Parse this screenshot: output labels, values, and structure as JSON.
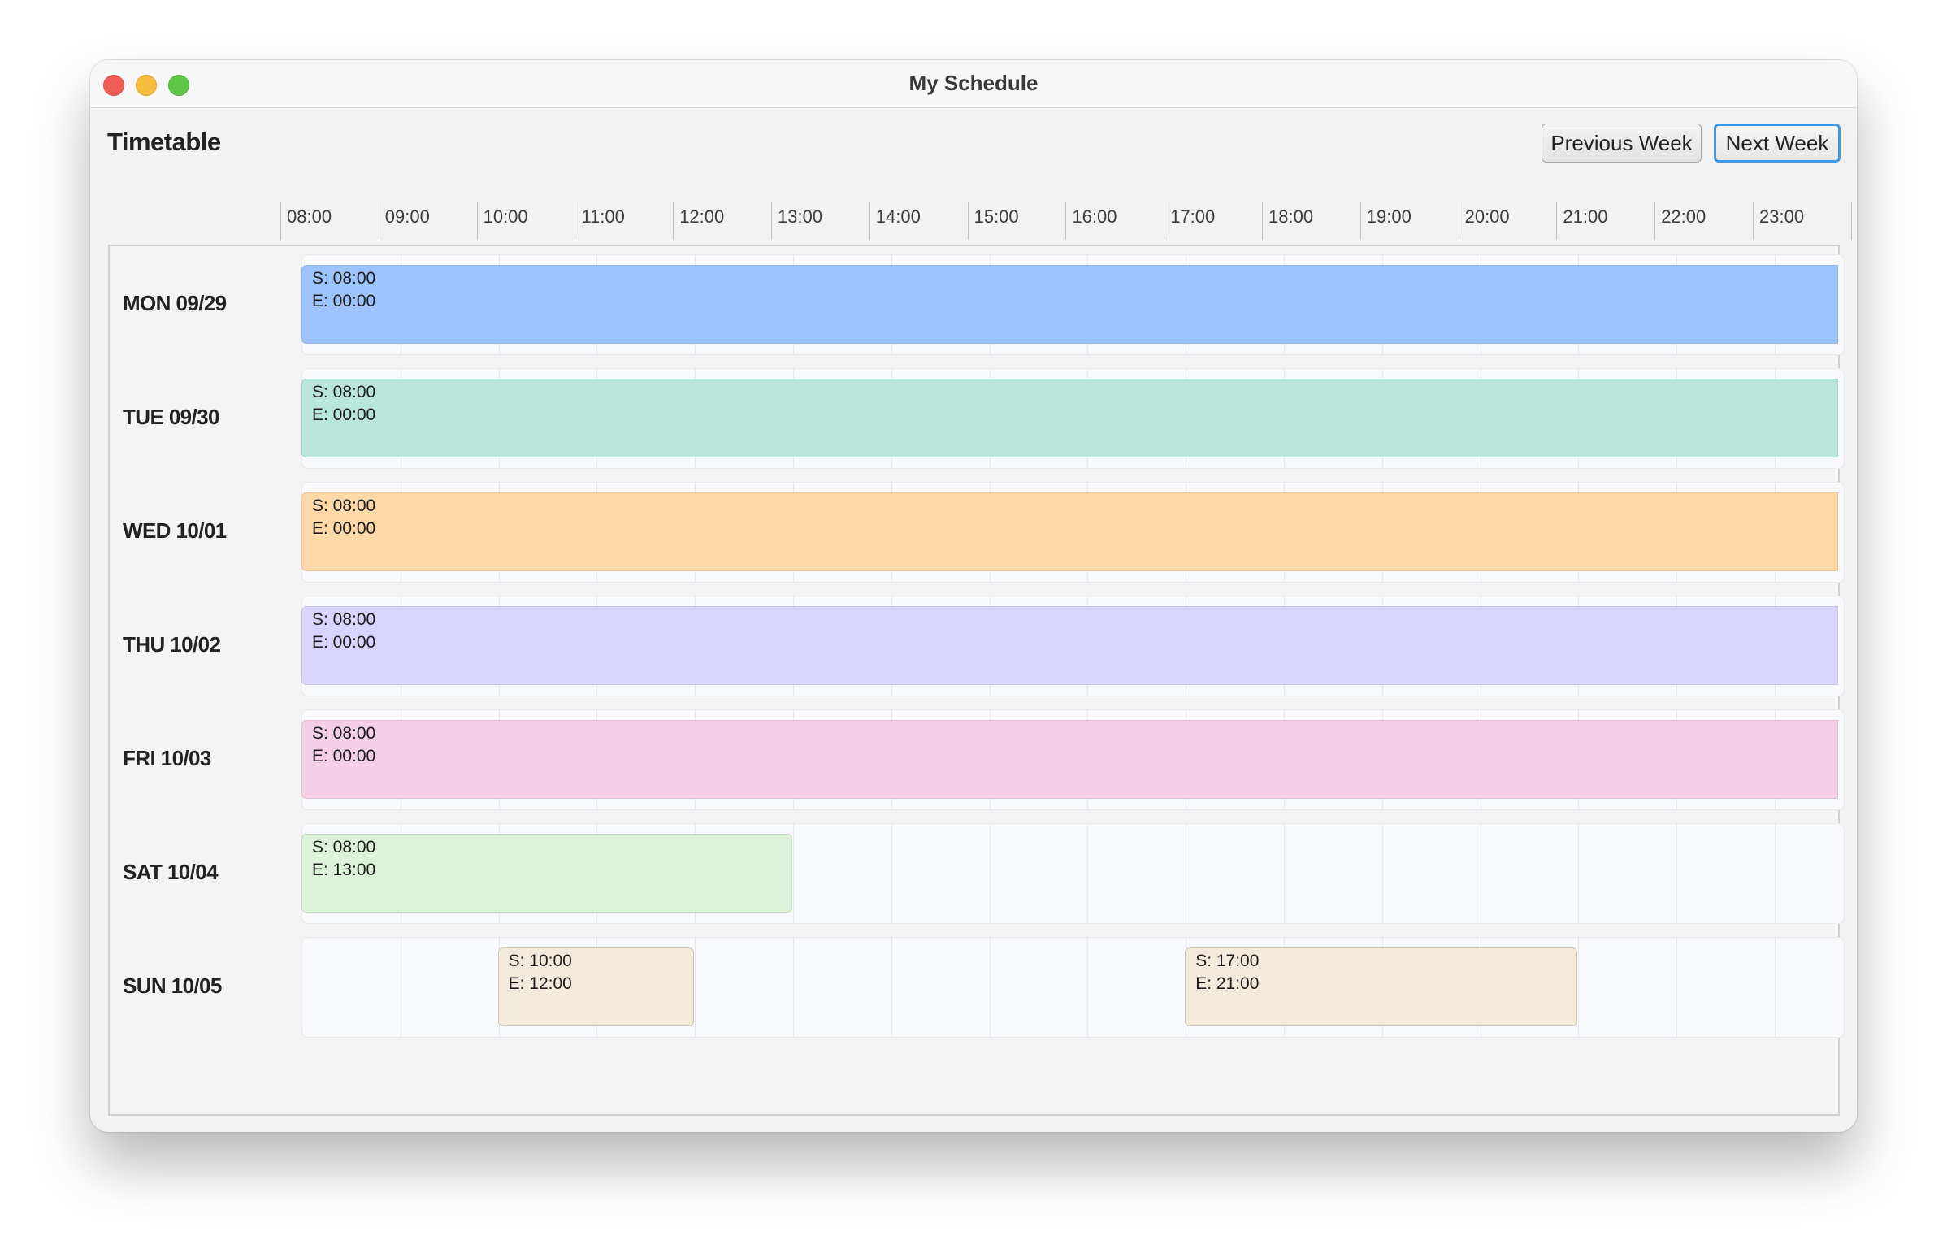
{
  "window": {
    "title": "My Schedule"
  },
  "header": {
    "title": "Timetable",
    "prev_label": "Previous Week",
    "next_label": "Next Week"
  },
  "hours": [
    "08:00",
    "09:00",
    "10:00",
    "11:00",
    "12:00",
    "13:00",
    "14:00",
    "15:00",
    "16:00",
    "17:00",
    "18:00",
    "19:00",
    "20:00",
    "21:00",
    "22:00",
    "23:00"
  ],
  "days": [
    {
      "label": "MON 09/29",
      "events": [
        {
          "start": "08:00",
          "end": "00:00",
          "start_text": "S: 08:00",
          "end_text": "E: 00:00",
          "color": "#9ec4fd",
          "border": "#8fb5ee"
        }
      ]
    },
    {
      "label": "TUE 09/30",
      "events": [
        {
          "start": "08:00",
          "end": "00:00",
          "start_text": "S: 08:00",
          "end_text": "E: 00:00",
          "color": "#b9e5da",
          "border": "#a8d6ca"
        }
      ]
    },
    {
      "label": "WED 10/01",
      "events": [
        {
          "start": "08:00",
          "end": "00:00",
          "start_text": "S: 08:00",
          "end_text": "E: 00:00",
          "color": "#fdd8a8",
          "border": "#ecc796"
        }
      ]
    },
    {
      "label": "THU 10/02",
      "events": [
        {
          "start": "08:00",
          "end": "00:00",
          "start_text": "S: 08:00",
          "end_text": "E: 00:00",
          "color": "#d8d4fb",
          "border": "#c7c3ea"
        }
      ]
    },
    {
      "label": "FRI 10/03",
      "events": [
        {
          "start": "08:00",
          "end": "00:00",
          "start_text": "S: 08:00",
          "end_text": "E: 00:00",
          "color": "#f5cfe6",
          "border": "#e4bed5"
        }
      ]
    },
    {
      "label": "SAT 10/04",
      "events": [
        {
          "start": "08:00",
          "end": "13:00",
          "start_text": "S: 08:00",
          "end_text": "E: 13:00",
          "color": "#dcf3d9",
          "border": "#c6dcc3"
        }
      ]
    },
    {
      "label": "SUN 10/05",
      "events": [
        {
          "start": "10:00",
          "end": "12:00",
          "start_text": "S: 10:00",
          "end_text": "E: 12:00",
          "color": "#f4eadb",
          "border": "#cfc5b6"
        },
        {
          "start": "17:00",
          "end": "21:00",
          "start_text": "S: 17:00",
          "end_text": "E: 21:00",
          "color": "#f4eadb",
          "border": "#cfc5b6"
        }
      ]
    }
  ]
}
